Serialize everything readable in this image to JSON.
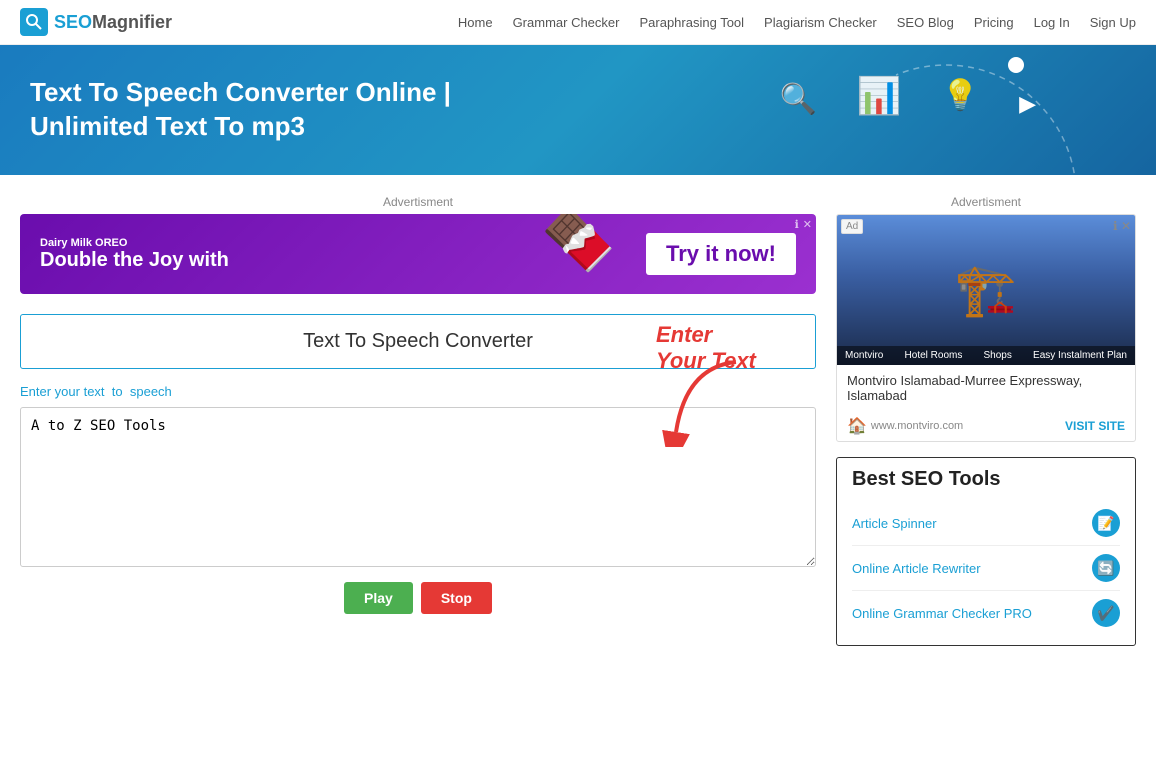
{
  "nav": {
    "logo_seo": "SEO",
    "logo_magnifier": "Magnifier",
    "links": [
      {
        "label": "Home",
        "href": "#"
      },
      {
        "label": "Grammar Checker",
        "href": "#"
      },
      {
        "label": "Paraphrasing Tool",
        "href": "#"
      },
      {
        "label": "Plagiarism Checker",
        "href": "#"
      },
      {
        "label": "SEO Blog",
        "href": "#"
      },
      {
        "label": "Pricing",
        "href": "#"
      },
      {
        "label": "Log In",
        "href": "#"
      },
      {
        "label": "Sign Up",
        "href": "#"
      }
    ]
  },
  "hero": {
    "title": "Text To Speech Converter Online | Unlimited Text To mp3"
  },
  "ad": {
    "label": "Advertisment",
    "brand": "Dairy Milk OREO",
    "text": "Double the Joy with",
    "cta": "Try it now!"
  },
  "tool": {
    "title": "Text To Speech Converter",
    "input_label_prefix": "Enter your text",
    "input_label_highlight": "to",
    "input_label_suffix": "speech",
    "placeholder": "A to Z SEO Tools",
    "textarea_value": "A to Z SEO Tools",
    "annotation_text": "Enter Your Text",
    "btn_play": "Play",
    "btn_stop": "Stop"
  },
  "sidebar": {
    "ad_label": "Advertisment",
    "ad_location": "Montviro Islamabad-Murree Expressway, Islamabad",
    "ad_domain": "www.montviro.com",
    "ad_visit": "VISIT SITE",
    "ad_badge": "Ad",
    "hotel_text": "Hotel Rooms",
    "shops_text": "Shops",
    "plan_text": "Easy Instalment Plan",
    "brand_name": "Montviro",
    "seo_tools_title": "Best SEO Tools",
    "tools": [
      {
        "label": "Article Spinner",
        "icon": "📝"
      },
      {
        "label": "Online Article Rewriter",
        "icon": "🔄"
      },
      {
        "label": "Online Grammar Checker PRO",
        "icon": "✔️"
      }
    ]
  }
}
